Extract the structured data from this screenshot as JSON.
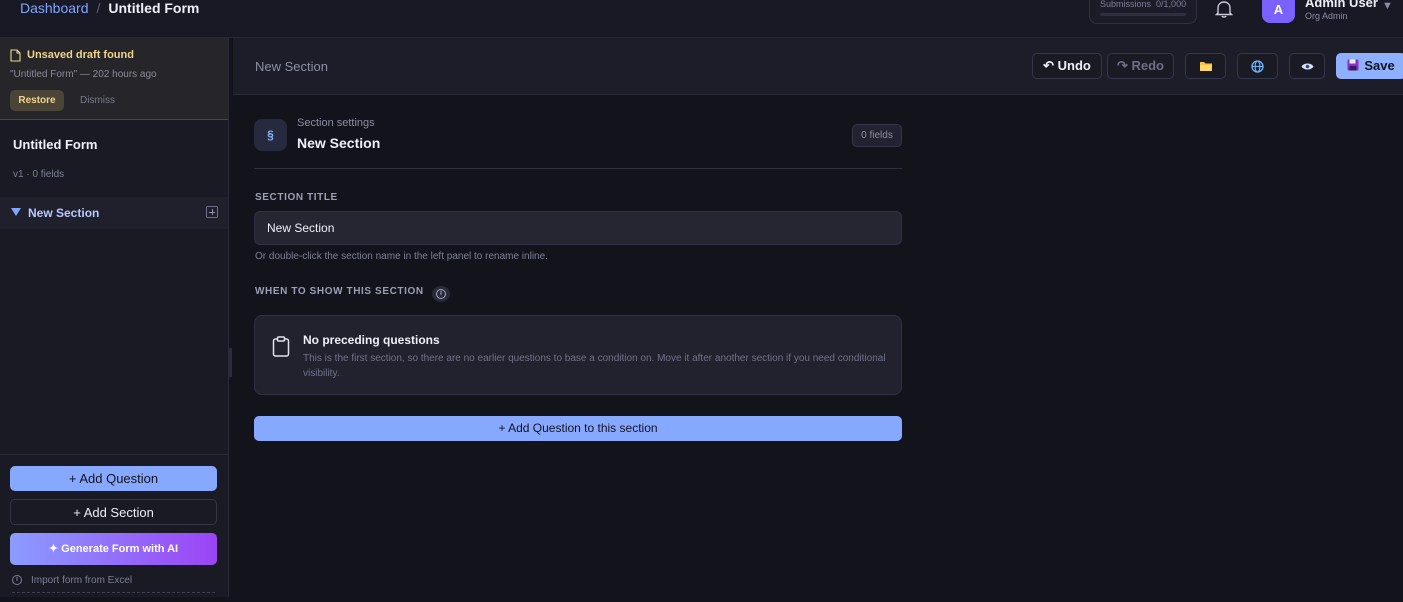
{
  "header": {
    "breadcrumb_link": "Dashboard",
    "breadcrumb_separator": "/",
    "breadcrumb_current": "Untitled Form",
    "submissions_label": "Submissions",
    "submissions_count": "0/1,000",
    "user_initial": "A",
    "user_name": "Admin User",
    "user_role": "Org Admin"
  },
  "draft_banner": {
    "title": "Unsaved draft found",
    "subtitle": "\"Untitled Form\" — 202 hours ago",
    "restore_label": "Restore",
    "dismiss_label": "Dismiss"
  },
  "sidebar": {
    "form_title": "Untitled Form",
    "form_meta": "v1 · 0 fields",
    "sections": [
      {
        "label": "New Section"
      }
    ],
    "add_question_label": "+ Add Question",
    "add_section_label": "+ Add Section",
    "generate_ai_label": "✦   Generate Form with AI",
    "import_label": "Import form from Excel"
  },
  "toolbar": {
    "title": "New Section",
    "undo_label": "↶ Undo",
    "redo_label": "↷ Redo",
    "save_label": "Save"
  },
  "section_settings": {
    "kicker": "Section settings",
    "title": "New Section",
    "icon_glyph": "§",
    "fields_count": "0 fields",
    "title_field_label": "SECTION TITLE",
    "title_field_value": "New Section",
    "title_hint": "Or double-click the section name in the left panel to rename inline.",
    "condition_label": "WHEN TO SHOW THIS SECTION",
    "empty_title": "No preceding questions",
    "empty_body": "This is the first section, so there are no earlier questions to base a condition on. Move it after another section if you need conditional visibility.",
    "add_question_label": "+ Add Question to this section"
  },
  "colors": {
    "accent": "#86a9ff",
    "draft_highlight": "#f1d48a",
    "avatar": "#7b61ff",
    "ai_gradient_start": "#8b9cff",
    "ai_gradient_end": "#9b44f5",
    "background": "#13131c"
  }
}
